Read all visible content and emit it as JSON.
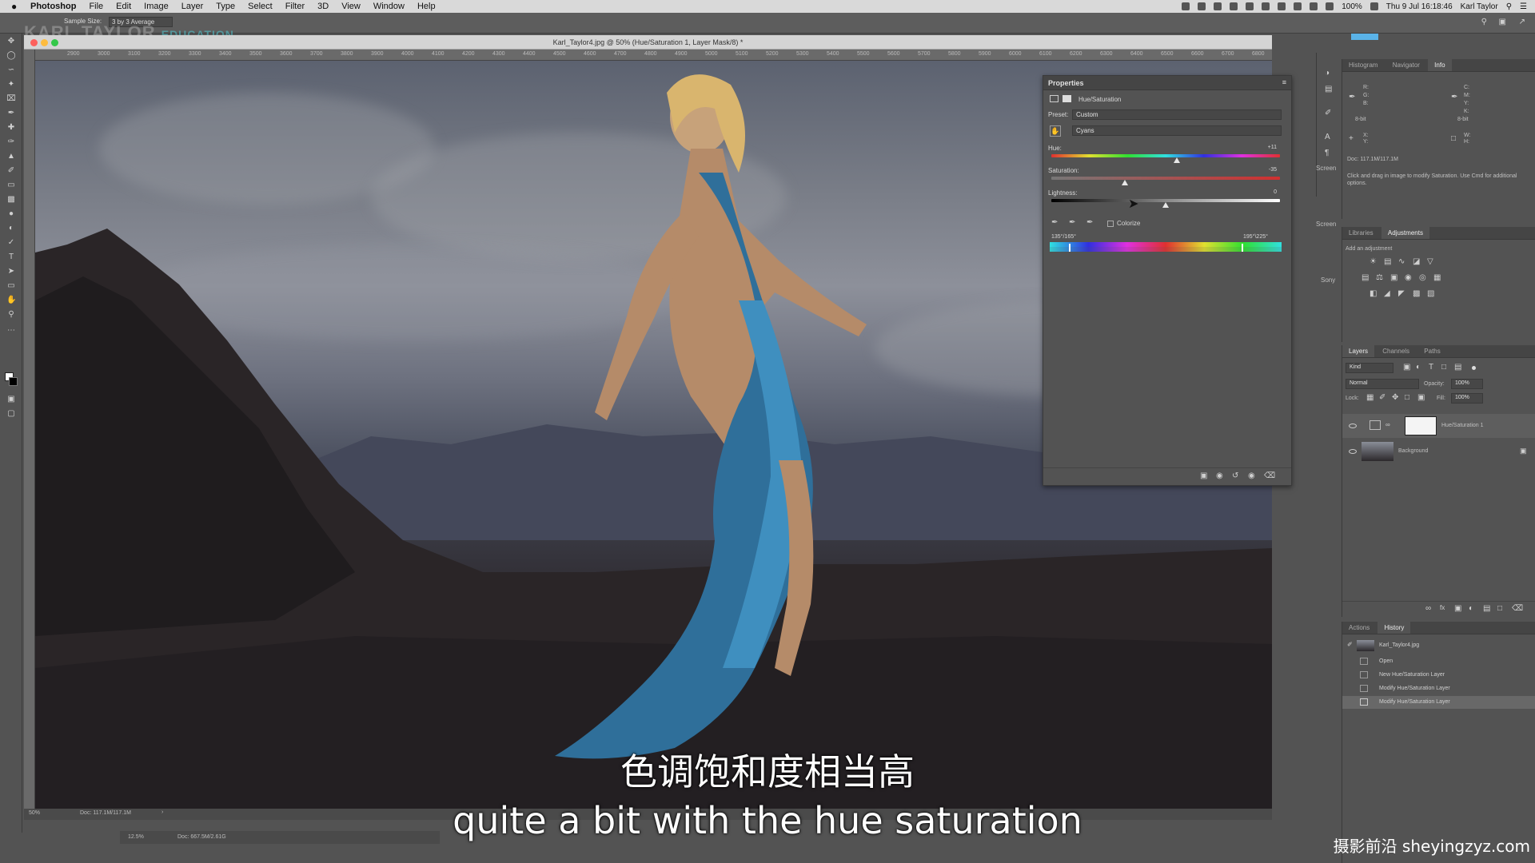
{
  "menubar": {
    "app": "Photoshop",
    "items": [
      "File",
      "Edit",
      "Image",
      "Layer",
      "Type",
      "Select",
      "Filter",
      "3D",
      "View",
      "Window",
      "Help"
    ],
    "zoom_battery": "100%",
    "datetime": "Thu 9 Jul 16:18:46",
    "user": "Karl Taylor"
  },
  "options": {
    "sample_size_label": "Sample Size:",
    "sample_size_value": "3 by 3 Average"
  },
  "brand": {
    "name": "KARL TAYLOR",
    "suffix": "EDUCATION"
  },
  "document": {
    "title": "Karl_Taylor4.jpg @ 50% (Hue/Saturation 1, Layer Mask/8) *",
    "ruler_ticks": [
      "2900",
      "3000",
      "3100",
      "3200",
      "3300",
      "3400",
      "3500",
      "3600",
      "3700",
      "3800",
      "3900",
      "4000",
      "4100",
      "4200",
      "4300",
      "4400",
      "4500",
      "4600",
      "4700",
      "4800",
      "4900",
      "5000",
      "5100",
      "5200",
      "5300",
      "5400",
      "5500",
      "5600",
      "5700",
      "5800",
      "5900",
      "6000",
      "6100",
      "6200",
      "6300",
      "6400",
      "6500",
      "6600",
      "6700",
      "6800"
    ],
    "status_zoom": "50%",
    "status_doc": "Doc: 117.1M/117.1M",
    "status_zoom2": "12.5%",
    "status_doc2": "Doc: 667.5M/2.61G"
  },
  "properties": {
    "title": "Properties",
    "adjustment": "Hue/Saturation",
    "preset_label": "Preset:",
    "preset_value": "Custom",
    "channel_value": "Cyans",
    "hue_label": "Hue:",
    "hue_value": "+11",
    "hue_level": 0.55,
    "saturation_label": "Saturation:",
    "saturation_value": "-35",
    "saturation_level": 0.32,
    "lightness_label": "Lightness:",
    "lightness_value": "0",
    "lightness_level": 0.5,
    "colorize_label": "Colorize",
    "range_left": "135°/165°",
    "range_right": "195°\\225°"
  },
  "right_dock": {
    "top_tabs": [
      "Histogram",
      "Navigator",
      "Info"
    ],
    "info_labels": [
      "R:",
      "G:",
      "B:",
      "8-bit",
      "C:",
      "M:",
      "Y:",
      "K:",
      "8-bit",
      "X:",
      "Y:",
      "W:",
      "H:"
    ],
    "doc_info": "Doc: 117.1M/117.1M",
    "info_hint": "Click and drag in image to modify Saturation. Use Cmd for additional options.",
    "adj_tabs": [
      "Libraries",
      "Adjustments"
    ],
    "adj_hint": "Add an adjustment",
    "side_labels": [
      "Screen",
      "Screen",
      "Sony"
    ],
    "layer_tabs": [
      "Layers",
      "Channels",
      "Paths"
    ],
    "kind_label": "Kind",
    "blend_mode": "Normal",
    "opacity_label": "Opacity:",
    "opacity_value": "100%",
    "lock_label": "Lock:",
    "fill_label": "Fill:",
    "fill_value": "100%",
    "layers": [
      "Hue/Saturation 1",
      "Background"
    ],
    "history_tabs": [
      "Actions",
      "History"
    ],
    "history_items": [
      "Karl_Taylor4.jpg",
      "Open",
      "New Hue/Saturation Layer",
      "Modify Hue/Saturation Layer",
      "Modify Hue/Saturation Layer"
    ]
  },
  "subtitles": {
    "cn": "色调饱和度相当高",
    "en": "quite a bit with the hue saturation"
  },
  "watermark": "摄影前沿 sheyingzyz.com"
}
